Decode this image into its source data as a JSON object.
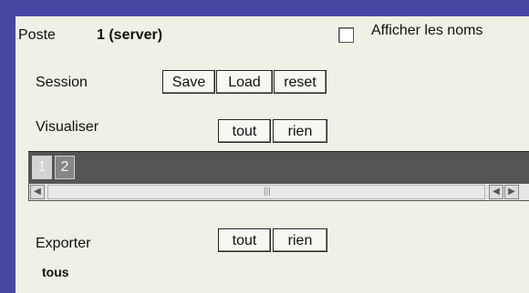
{
  "header": {
    "poste_label": "Poste",
    "poste_value": "1 (server)",
    "show_names_label": "Afficher les noms",
    "show_names_checked": false
  },
  "session": {
    "label": "Session",
    "save_label": "Save",
    "load_label": "Load",
    "reset_label": "reset"
  },
  "visualiser": {
    "label": "Visualiser",
    "all_label": "tout",
    "none_label": "rien"
  },
  "tabs": [
    {
      "label": "1"
    },
    {
      "label": "2"
    }
  ],
  "scrollbar": {
    "left_arrow_icon": "arrow-left-icon",
    "right_arrow_icon": "arrow-right-icon"
  },
  "exporter": {
    "label": "Exporter",
    "all_label": "tout",
    "none_label": "rien",
    "status": "tous"
  },
  "colors": {
    "desktop_bg": "#4a4aa6",
    "panel_bg": "#f0f0e6",
    "tabbar_bg": "#555555"
  }
}
